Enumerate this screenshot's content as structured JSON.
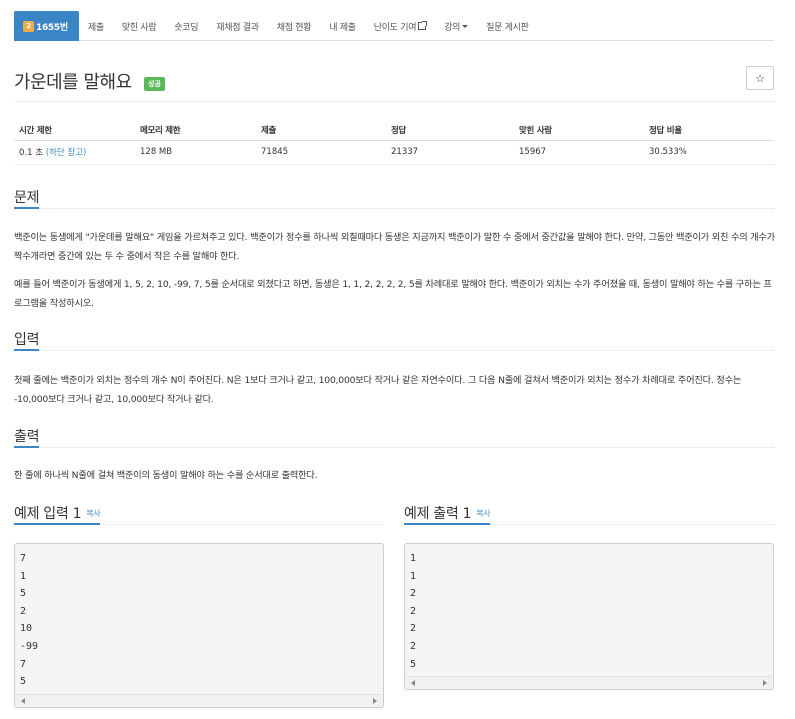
{
  "nav": {
    "problem_number": "1655번",
    "badge": "2",
    "items": [
      "제출",
      "맞힌 사람",
      "숏코딩",
      "재채점 결과",
      "채점 현황",
      "내 제출",
      "난이도 기여",
      "강의",
      "질문 게시판"
    ]
  },
  "problem": {
    "title": "가운데를 말해요",
    "result_badge": "성공",
    "star": "☆"
  },
  "info": {
    "headers": [
      "시간 제한",
      "메모리 제한",
      "제출",
      "정답",
      "맞힌 사람",
      "정답 비율"
    ],
    "time_limit": "0.1 초",
    "time_note": "(하단 참고)",
    "memory_limit": "128 MB",
    "submissions": "71845",
    "accepted": "21337",
    "solvers": "15967",
    "ratio": "30.533%"
  },
  "sections": {
    "problem_heading": "문제",
    "problem_p1": "백준이는 동생에게 \"가운데를 말해요\" 게임을 가르쳐주고 있다. 백준이가 정수를 하나씩 외칠때마다 동생은 지금까지 백준이가 말한 수 중에서 중간값을 말해야 한다. 만약, 그동안 백준이가 외친 수의 개수가 짝수개라면 중간에 있는 두 수 중에서 작은 수를 말해야 한다.",
    "problem_p2": "예를 들어 백준이가 동생에게 1, 5, 2, 10, -99, 7, 5를 순서대로 외쳤다고 하면, 동생은 1, 1, 2, 2, 2, 2, 5를 차례대로 말해야 한다. 백준이가 외치는 수가 주어졌을 때, 동생이 말해야 하는 수를 구하는 프로그램을 작성하시오.",
    "input_heading": "입력",
    "input_p": "첫째 줄에는 백준이가 외치는 정수의 개수 N이 주어진다. N은 1보다 크거나 같고, 100,000보다 작거나 같은 자연수이다. 그 다음 N줄에 걸쳐서 백준이가 외치는 정수가 차례대로 주어진다. 정수는 -10,000보다 크거나 같고, 10,000보다 작거나 같다.",
    "output_heading": "출력",
    "output_p": "한 줄에 하나씩 N줄에 걸쳐 백준이의 동생이 말해야 하는 수를 순서대로 출력한다."
  },
  "samples": {
    "input_heading": "예제 입력 1",
    "output_heading": "예제 출력 1",
    "copy": "복사",
    "input_text": "7\n1\n5\n2\n10\n-99\n7\n5",
    "output_text": "1\n1\n2\n2\n2\n2\n5"
  }
}
